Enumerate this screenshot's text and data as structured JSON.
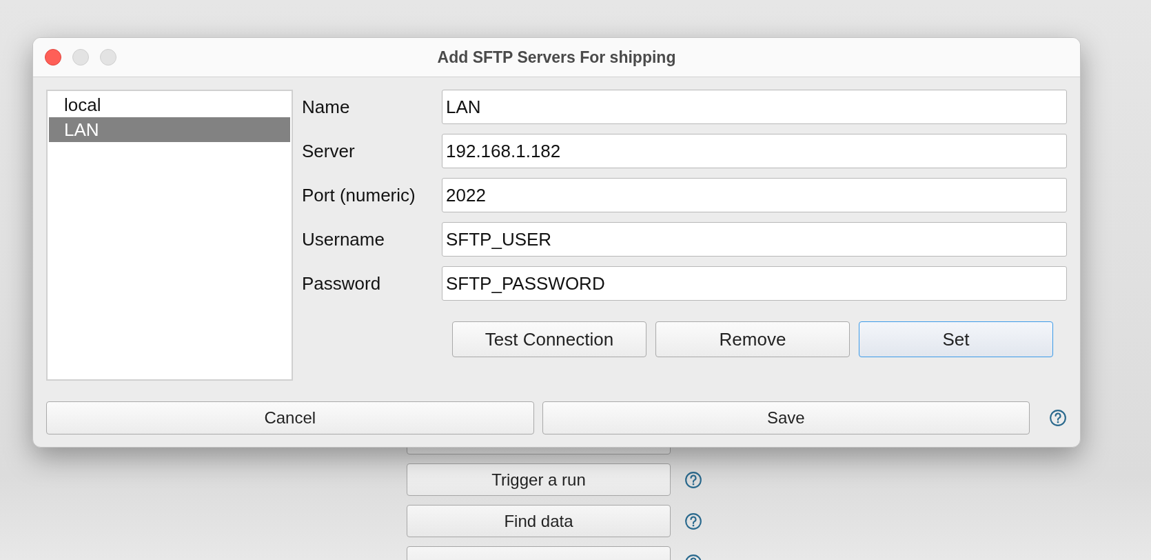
{
  "background": {
    "buttons": [
      {
        "kind": "sliver"
      },
      {
        "kind": "button",
        "label": "Trigger a run"
      },
      {
        "kind": "button",
        "label": "Find data"
      },
      {
        "kind": "covered"
      }
    ]
  },
  "window": {
    "title": "Add SFTP Servers For shipping",
    "servers": [
      {
        "label": "local",
        "selected": false
      },
      {
        "label": "LAN",
        "selected": true
      }
    ],
    "fields": [
      {
        "label": "Name",
        "value": "LAN"
      },
      {
        "label": "Server",
        "value": "192.168.1.182"
      },
      {
        "label": "Port (numeric)",
        "value": "2022"
      },
      {
        "label": "Username",
        "value": "SFTP_USER"
      },
      {
        "label": "Password",
        "value": "SFTP_PASSWORD"
      }
    ],
    "actions": [
      {
        "label": "Test Connection",
        "default": false
      },
      {
        "label": "Remove",
        "default": false
      },
      {
        "label": "Set",
        "default": true
      }
    ],
    "buttons": [
      "Cancel",
      "Save"
    ]
  }
}
